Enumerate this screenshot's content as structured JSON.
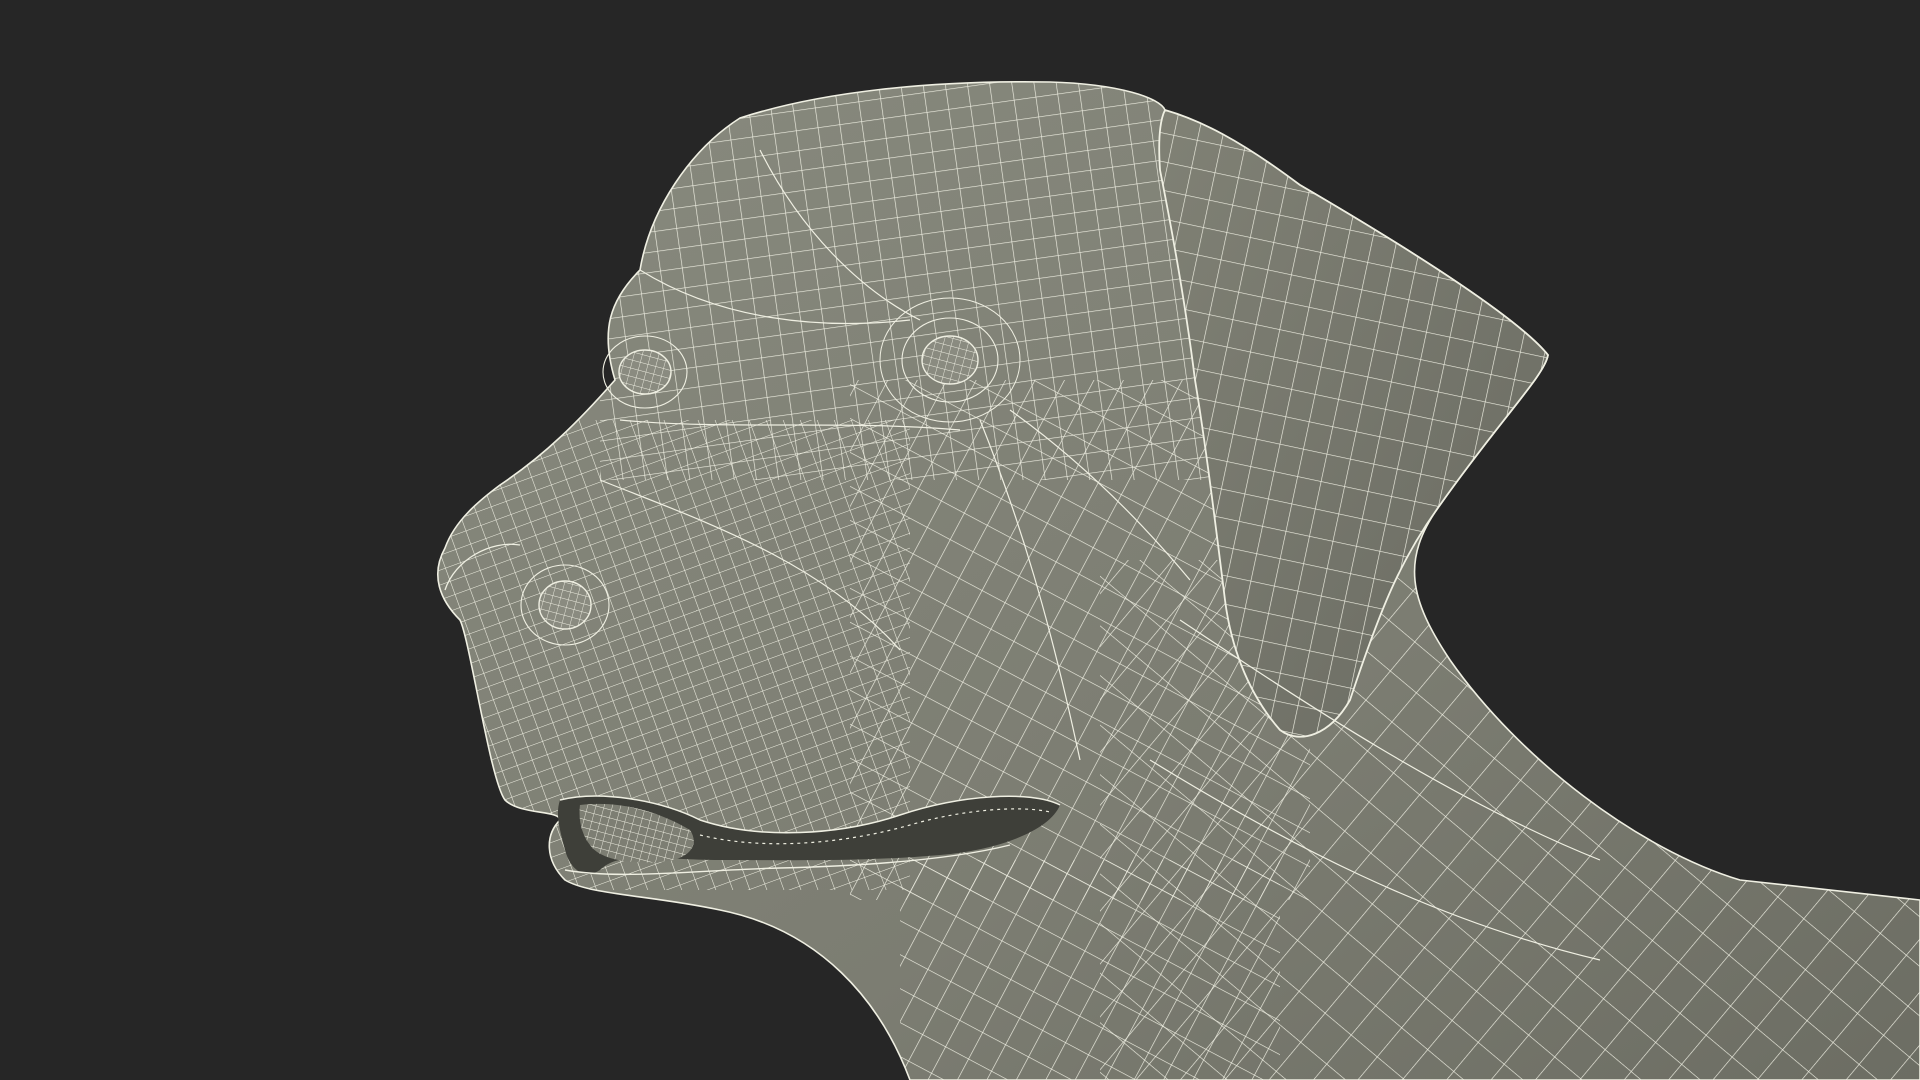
{
  "scene": {
    "subject": "dog-head-wireframe",
    "colors": {
      "background": "#262626",
      "surface": "#7e7f74",
      "surface_shadow": "#5f6058",
      "wire": "#efefe2",
      "cavity": "#3c3d38"
    }
  }
}
